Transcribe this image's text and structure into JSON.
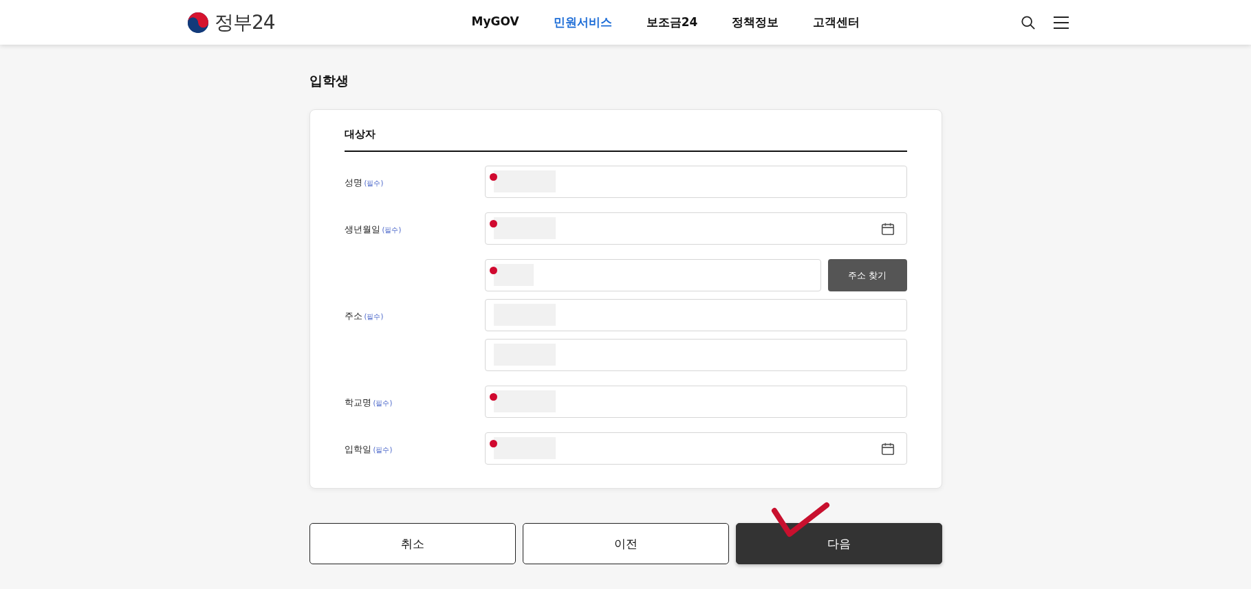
{
  "header": {
    "logo_text": "정부24",
    "nav": [
      {
        "label": "MyGOV",
        "selected": false
      },
      {
        "label": "민원서비스",
        "selected": true
      },
      {
        "label": "보조금24",
        "selected": false
      },
      {
        "label": "정책정보",
        "selected": false
      },
      {
        "label": "고객센터",
        "selected": false
      }
    ]
  },
  "page_title": "입학생",
  "form": {
    "section_title": "대상자",
    "rows": [
      {
        "label": "성명",
        "required": "(필수)",
        "inputs": [
          {
            "kind": "text",
            "marked": true,
            "redacted": true
          }
        ]
      },
      {
        "label": "생년월일",
        "required": "(필수)",
        "inputs": [
          {
            "kind": "date",
            "marked": true,
            "redacted": true
          }
        ]
      },
      {
        "label": "주소",
        "required": "(필수)",
        "inputs": [
          {
            "kind": "search",
            "marked": true,
            "redacted": true,
            "button": "주소 찾기"
          },
          {
            "kind": "text",
            "marked": false,
            "redacted": true
          },
          {
            "kind": "text",
            "marked": false,
            "redacted": true
          }
        ]
      },
      {
        "label": "학교명",
        "required": "(필수)",
        "inputs": [
          {
            "kind": "text",
            "marked": true,
            "redacted": true
          }
        ]
      },
      {
        "label": "입학일",
        "required": "(필수)",
        "inputs": [
          {
            "kind": "date",
            "marked": true,
            "redacted": true
          }
        ]
      }
    ]
  },
  "buttons": [
    {
      "label": "취소",
      "kind": "outline",
      "checkmark": false
    },
    {
      "label": "이전",
      "kind": "outline",
      "checkmark": false
    },
    {
      "label": "다음",
      "kind": "primary",
      "checkmark": true
    }
  ]
}
